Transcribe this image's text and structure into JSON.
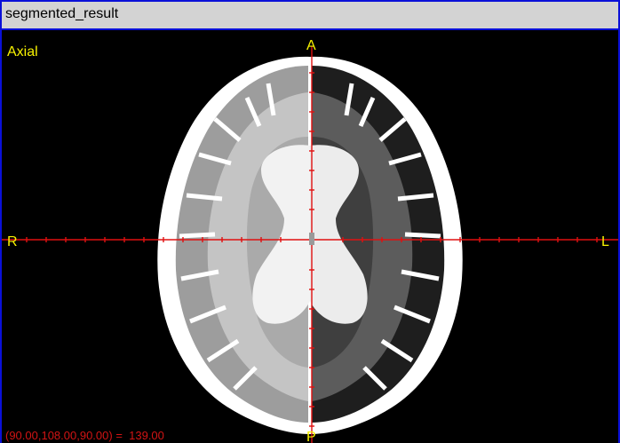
{
  "window": {
    "title": "segmented_result"
  },
  "viewer": {
    "view_label": "Axial",
    "orientation": {
      "anterior": "A",
      "posterior": "P",
      "right": "R",
      "left": "L"
    },
    "readout": "(90.00,108.00,90.00) =  139.00"
  },
  "colors": {
    "window_border": "#0a10d8",
    "titlebar_bg": "#d3d3d3",
    "view_label": "#f7f200",
    "orientation_text": "#f7f200",
    "crosshair": "#e01010",
    "readout_text": "#d21414"
  }
}
